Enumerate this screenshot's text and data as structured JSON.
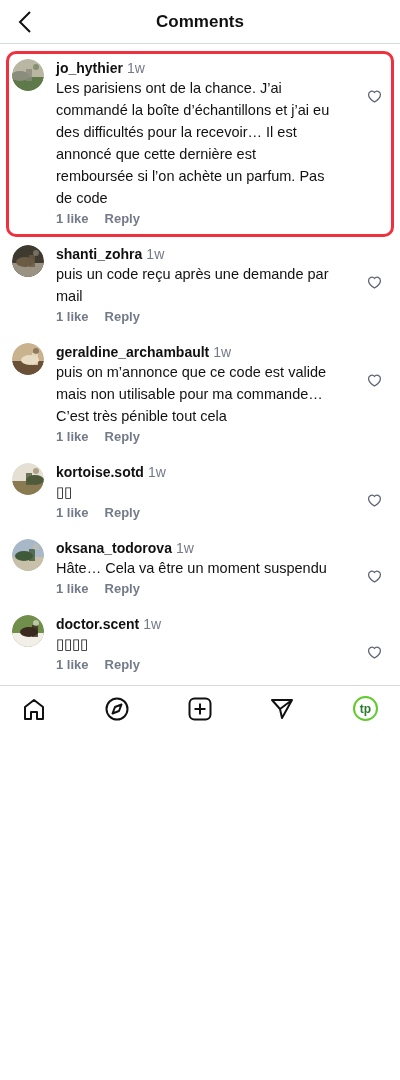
{
  "header": {
    "title": "Comments"
  },
  "comments": [
    {
      "username": "jo_hythier",
      "time": "1w",
      "text": "Les parisiens ont de la chance. J’ai commandé la boîte d’échantillons et j’ai eu des difficultés pour la recevoir… Il est annoncé que cette dernière est remboursée si l’on achète un parfum. Pas de code",
      "likes": "1 like",
      "reply": "Reply",
      "highlighted": true,
      "liked": false
    },
    {
      "username": "shanti_zohra",
      "time": "1w",
      "text": "puis un code reçu après une demande par mail",
      "likes": "1 like",
      "reply": "Reply",
      "highlighted": false,
      "liked": false
    },
    {
      "username": "geraldine_archambault",
      "time": "1w",
      "text": "puis on m’annonce que ce code est valide mais non utilisable pour ma commande… C’est très pénible tout cela",
      "likes": "1 like",
      "reply": "Reply",
      "highlighted": false,
      "liked": false
    },
    {
      "username": "kortoise.sotd",
      "time": "1w",
      "text": "▯▯",
      "likes": "1 like",
      "reply": "Reply",
      "highlighted": false,
      "liked": false
    },
    {
      "username": "oksana_todorova",
      "time": "1w",
      "text": "Hâte… Cela va être un moment suspendu",
      "likes": "1 like",
      "reply": "Reply",
      "highlighted": false,
      "liked": false
    },
    {
      "username": "doctor.scent",
      "time": "1w",
      "text": "▯▯▯▯",
      "likes": "1 like",
      "reply": "Reply",
      "highlighted": false,
      "liked": false
    }
  ],
  "nav": {
    "profile_initials": "tp"
  }
}
